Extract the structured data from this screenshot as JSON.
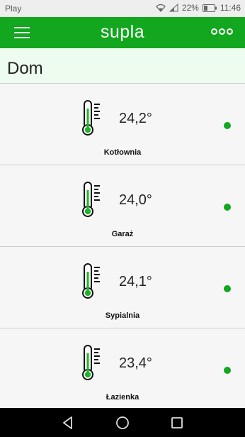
{
  "status_bar": {
    "carrier": "Play",
    "battery": "22%",
    "time": "11:46",
    "icons": [
      "wifi-icon",
      "signal-icon",
      "battery-icon"
    ]
  },
  "app_bar": {
    "logo": "supla",
    "color": "#12a71e",
    "icons": [
      "menu-icon",
      "more-icon"
    ]
  },
  "location": {
    "name": "Dom",
    "background": "#eefbef"
  },
  "channels": [
    {
      "temperature": "24,2°",
      "caption": "Kotłownia",
      "icon": "thermometer-icon",
      "status": "online"
    },
    {
      "temperature": "24,0°",
      "caption": "Garaż",
      "icon": "thermometer-icon",
      "status": "online"
    },
    {
      "temperature": "24,1°",
      "caption": "Sypialnia",
      "icon": "thermometer-icon",
      "status": "online"
    },
    {
      "temperature": "23,4°",
      "caption": "Łazienka",
      "icon": "thermometer-icon",
      "status": "online"
    }
  ],
  "nav_bar": {
    "icons": [
      "back-icon",
      "home-icon",
      "recents-icon"
    ]
  }
}
